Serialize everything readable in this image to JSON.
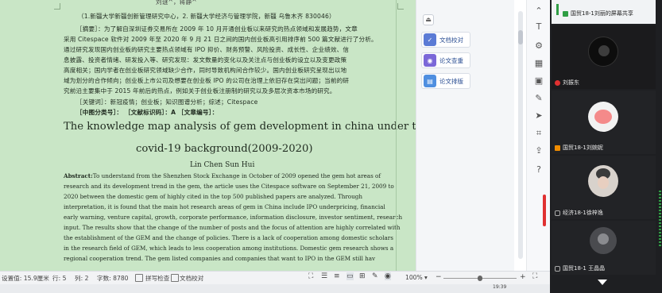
{
  "document": {
    "header_top": "刘谜^，蒋静^",
    "affiliation": "（1.新疆大学新疆创新管理研究中心，2. 新疆大学经济与管理学院，新疆 乌鲁木齐 830046）",
    "abstract_cn": [
      "［摘要］：为了解自深圳证券交易所在 2009 年 10 月开通创业板以来研究的热点领域和发展趋势，文章",
      "采用 Citespace 软件对 2009 年至 2020 年 9 月 21 日之间的国内创业板高引用排序前 500 篇文献进行了分析。",
      "通过研究发现国内创业板的研究主要热点领域有 IPO 抑价、财务预警、风险投资、成长性、企业绩效、信",
      "息披露、投资者情绪、研发投入等、研究发现：发文数量的变化以及关注点与创业板的设立以及变更政策",
      "高度相关；国内学者在创业板研究领域缺少合作，同时导致机构间合作较少。国内创业板研究呈现出以地",
      "域为划分的合作倾向；创业板上市公司及想要在创业板 IPO 的公司在治理上依旧存在突出问题；当前的研",
      "究前沿主要集中于 2015 年前后的热点，例如关于创业板注册制的研究以及多层次资本市场的研究。"
    ],
    "keywords": "［关键词］：新冠疫情；创业板；知识图谱分析；综述；Citespace",
    "classification": "［中图分类号］：   ［文献标识码］：A   ［文章编号］：",
    "title_line1": "The knowledge map analysis of gem development in china under the",
    "title_line2": "covid-19 background(2009-2020)",
    "authors": "Lin Chen   Sun Hui",
    "abstract_en_label": "Abstract:",
    "abstract_en": [
      "To understand from the Shenzhen Stock Exchange in October of 2009 opened the gem hot areas of",
      "research and its development trend in the gem, the article uses the Citespace software on September 21, 2009 to",
      "2020 between the domestic gem of highly cited in the top 500 published papers are analyzed. Through",
      "interpretation, it is found that the main hot research areas of gem in China include IPO underpricing, financial",
      "early warning, venture capital, growth, corporate performance, information disclosure, investor sentiment, research",
      "input. The results show that the change of the number of posts and the focus of attention are highly correlated with",
      "the establishment of the GEM and the change of policies. There is a lack of cooperation among domestic scholars",
      "in the research field of GEM, which leads to less cooperation among institutions. Domestic gem research shows a",
      "regional cooperation trend. The gem listed companies and companies that want to IPO in the GEM still hav"
    ]
  },
  "side_panel": {
    "buttons": [
      {
        "label": "文档校对",
        "icon": "doc-check-icon",
        "color": "#5b7bd5"
      },
      {
        "label": "论文查重",
        "icon": "plagiarism-check-icon",
        "color": "#7b68d8"
      },
      {
        "label": "论文排版",
        "icon": "layout-icon",
        "color": "#4f8fe0"
      }
    ]
  },
  "tools": {
    "icons": [
      "collapse-icon",
      "text-icon",
      "format-icon",
      "doc-icon",
      "doc2-icon",
      "edit-icon",
      "cursor-icon",
      "crop-icon",
      "share-icon",
      "help-icon"
    ]
  },
  "status_bar": {
    "setting_value": "设置值: 15.9厘米",
    "row": "行: 5",
    "col": "列: 2",
    "word_count": "字数: 8780",
    "spell_check": "拼写检查",
    "doc_proof": "文档校对",
    "zoom": "100%",
    "zoom_level": 0.5
  },
  "taskbar": {
    "time": "19:39"
  },
  "meeting": {
    "tiles": [
      {
        "name": "国贸18-1刘丽的屏幕共享",
        "icon": "screen-share-icon",
        "accent": "#2f9e44"
      },
      {
        "name": "刘振东",
        "icon": "mic-off-icon",
        "accent": "#e03131"
      },
      {
        "name": "国贸18-1刘婉妮",
        "icon": "user-icon",
        "accent": "#f08c00"
      },
      {
        "name": "经济18-1徐梓逸",
        "icon": "mic-icon",
        "accent": "#555"
      },
      {
        "name": "国贸18-1 王晶晶",
        "icon": "mic-icon",
        "accent": "#555"
      }
    ]
  }
}
